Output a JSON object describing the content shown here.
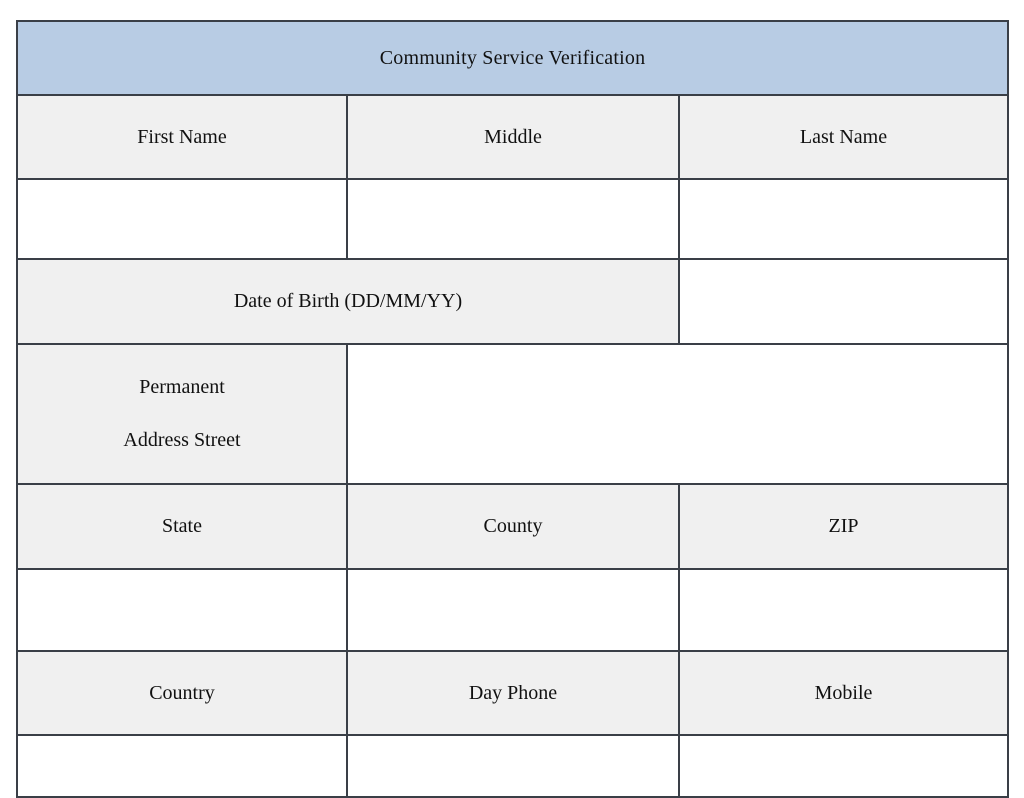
{
  "document": {
    "title": "Community Service Verification",
    "header_fill": "#b8cce4",
    "label_fill": "#f0f0f0",
    "input_fill": "#ffffff",
    "border_color": "#3a3f47"
  },
  "rows": {
    "names": {
      "first_name": "First Name",
      "middle": "Middle",
      "last_name": "Last Name"
    },
    "names_input": {
      "first_name_value": "",
      "middle_value": "",
      "last_name_value": ""
    },
    "dob": {
      "label": "Date of Birth (DD/MM/YY)",
      "value": ""
    },
    "address": {
      "label_line1": "Permanent",
      "label_line2": "Address Street",
      "value": ""
    },
    "location": {
      "state": "State",
      "county": "County",
      "zip": "ZIP"
    },
    "location_input": {
      "state_value": "",
      "county_value": "",
      "zip_value": ""
    },
    "contact": {
      "country": "Country",
      "day_phone": "Day Phone",
      "mobile": "Mobile"
    },
    "contact_input": {
      "country_value": "",
      "day_phone_value": "",
      "mobile_value": ""
    }
  }
}
